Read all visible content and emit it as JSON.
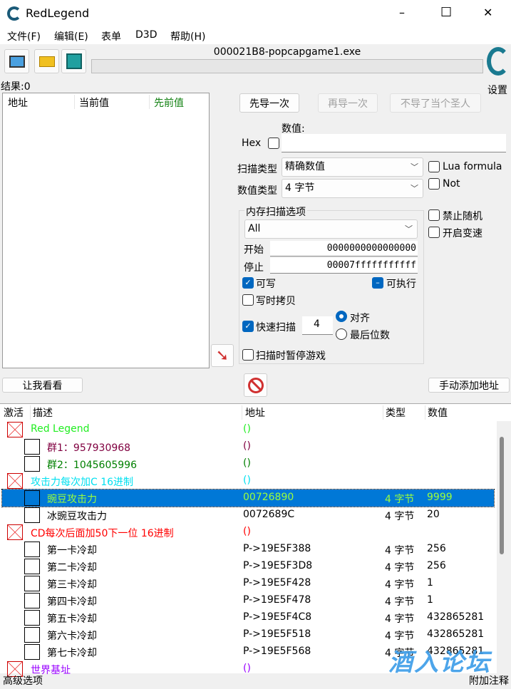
{
  "window": {
    "title": "RedLegend",
    "minimize": "–",
    "maximize": "☐",
    "close": "✕"
  },
  "menu": [
    "文件(F)",
    "编辑(E)",
    "表单",
    "D3D",
    "帮助(H)"
  ],
  "process": "000021B8-popcapgame1.exe",
  "settings_label": "设置",
  "results": "结果:0",
  "found_list": {
    "columns": [
      "地址",
      "当前值",
      "先前值"
    ]
  },
  "scan": {
    "first_scan": "先导一次",
    "next_scan": "再导一次",
    "undo_scan": "不导了当个圣人",
    "value_label": "数值:",
    "hex_label": "Hex",
    "value": "",
    "scan_type_label": "扫描类型",
    "scan_type": "精确数值",
    "value_type_label": "数值类型",
    "value_type": "4 字节",
    "lua_formula": "Lua formula",
    "not": "Not",
    "mem_options_title": "内存扫描选项",
    "region": "All",
    "start_label": "开始",
    "start": "0000000000000000",
    "stop_label": "停止",
    "stop": "00007fffffffffff",
    "writable": "可写",
    "executable": "可执行",
    "copy_on_write": "写时拷贝",
    "fast_scan": "快速扫描",
    "fast_scan_value": "4",
    "align": "对齐",
    "last_digits": "最后位数",
    "pause_game": "扫描时暂停游戏",
    "no_random": "禁止随机",
    "speedhack": "开启变速"
  },
  "memory_view": "让我看看",
  "add_address": "手动添加地址",
  "table": {
    "columns": [
      "激活",
      "描述",
      "地址",
      "类型",
      "数值"
    ],
    "rows": [
      {
        "group": true,
        "desc": "Red Legend",
        "addr": "()",
        "type": "",
        "value": "",
        "color": "#22ee22"
      },
      {
        "desc": "群1：957930968",
        "addr": "()",
        "type": "",
        "value": "",
        "color": "#800040"
      },
      {
        "desc": "群2：1045605996",
        "addr": "()",
        "type": "",
        "value": "",
        "color": "#008000"
      },
      {
        "group": true,
        "desc": "攻击力每次加C   16进制",
        "addr": "()",
        "type": "",
        "value": "",
        "color": "#00e0f0"
      },
      {
        "selected": true,
        "desc": "豌豆攻击力",
        "addr": "00726890",
        "type": "4 字节",
        "value": "9999",
        "color": "#9cff3c"
      },
      {
        "desc": "冰豌豆攻击力",
        "addr": "0072689C",
        "type": "4 字节",
        "value": "20",
        "color": "#000000"
      },
      {
        "group": true,
        "desc": "CD每次后面加50下一位 16进制",
        "addr": "()",
        "type": "",
        "value": "",
        "color": "#ff0000"
      },
      {
        "desc": "第一卡冷却",
        "addr": "P->19E5F388",
        "type": "4 字节",
        "value": "256",
        "color": "#000000"
      },
      {
        "desc": "第二卡冷却",
        "addr": "P->19E5F3D8",
        "type": "4 字节",
        "value": "256",
        "color": "#000000"
      },
      {
        "desc": "第三卡冷却",
        "addr": "P->19E5F428",
        "type": "4 字节",
        "value": "1",
        "color": "#000000"
      },
      {
        "desc": "第四卡冷却",
        "addr": "P->19E5F478",
        "type": "4 字节",
        "value": "1",
        "color": "#000000"
      },
      {
        "desc": "第五卡冷却",
        "addr": "P->19E5F4C8",
        "type": "4 字节",
        "value": "432865281",
        "color": "#000000"
      },
      {
        "desc": "第六卡冷却",
        "addr": "P->19E5F518",
        "type": "4 字节",
        "value": "432865281",
        "color": "#000000"
      },
      {
        "desc": "第七卡冷却",
        "addr": "P->19E5F568",
        "type": "4 字节",
        "value": "432865281",
        "color": "#000000"
      },
      {
        "group": true,
        "desc": "世界基址",
        "addr": "()",
        "type": "",
        "value": "",
        "color": "#9900ff"
      }
    ]
  },
  "status": {
    "advanced": "高级选项",
    "comments": "附加注释"
  },
  "watermark": "酒入论坛"
}
